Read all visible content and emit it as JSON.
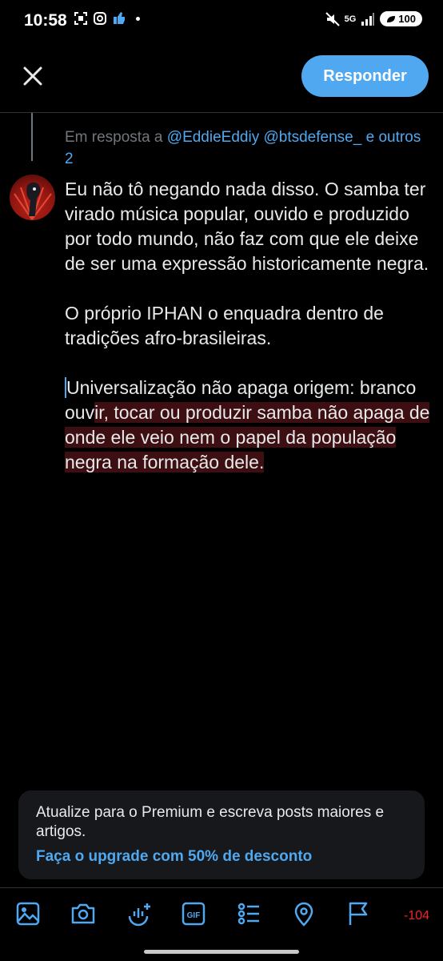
{
  "status_bar": {
    "time": "10:58",
    "battery": "100",
    "network": "5G"
  },
  "header": {
    "reply_label": "Responder"
  },
  "reply_context": {
    "prefix": "Em resposta a",
    "user1": "@EddieEddiy",
    "user2": "@btsdefense_",
    "suffix_e": "e",
    "others": "outros 2"
  },
  "compose": {
    "p1": "Eu não tô negando nada disso. O samba ter virado música popular, ouvido e produzido por todo mundo, não faz com que ele deixe de ser uma expressão historicamente negra.",
    "p2": "O próprio IPHAN o enquadra dentro de tradições afro-brasileiras.",
    "p3_within": "Universalização não apaga origem: branco ouv",
    "p3_over": "ir, tocar ou produzir samba não apaga de onde ele veio nem o papel da população negra na formação dele."
  },
  "premium": {
    "text": "Atualize para o Premium e escreva posts maiores e artigos.",
    "link": "Faça o upgrade com 50% de desconto"
  },
  "toolbar": {
    "counter": "-104",
    "icons": [
      "image-icon",
      "camera-icon",
      "voice-icon",
      "gif-icon",
      "poll-icon",
      "location-icon",
      "flag-icon"
    ]
  },
  "colors": {
    "accent": "#4fa8f0",
    "over_limit": "#f4212e",
    "over_limit_bg": "#3d0f12"
  }
}
